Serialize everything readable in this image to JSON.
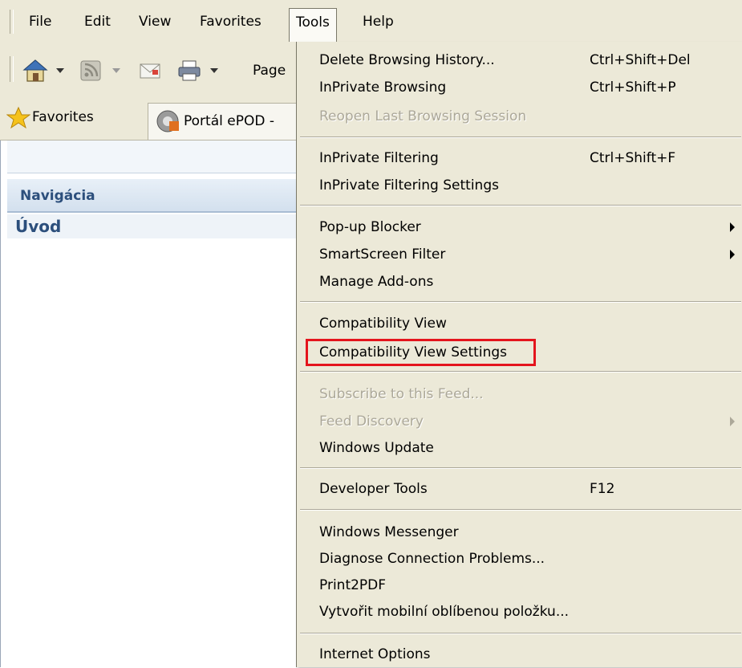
{
  "menubar": {
    "items": [
      "File",
      "Edit",
      "View",
      "Favorites",
      "Tools",
      "Help"
    ],
    "active": "Tools"
  },
  "commandbar": {
    "page_label": "Page"
  },
  "favoritesbar": {
    "favorites_label": "Favorites",
    "tab_title": "Portál ePOD -"
  },
  "page": {
    "nav_header": "Navigácia",
    "nav_items": [
      "Úvod"
    ]
  },
  "tools_menu": {
    "groups": [
      [
        {
          "label": "Delete Browsing History...",
          "shortcut": "Ctrl+Shift+Del",
          "enabled": true
        },
        {
          "label": "InPrivate Browsing",
          "shortcut": "Ctrl+Shift+P",
          "enabled": true
        },
        {
          "label": "Reopen Last Browsing Session",
          "shortcut": "",
          "enabled": false
        }
      ],
      [
        {
          "label": "InPrivate Filtering",
          "shortcut": "Ctrl+Shift+F",
          "enabled": true
        },
        {
          "label": "InPrivate Filtering Settings",
          "shortcut": "",
          "enabled": true
        }
      ],
      [
        {
          "label": "Pop-up Blocker",
          "shortcut": "",
          "enabled": true,
          "submenu": true
        },
        {
          "label": "SmartScreen Filter",
          "shortcut": "",
          "enabled": true,
          "submenu": true
        },
        {
          "label": "Manage Add-ons",
          "shortcut": "",
          "enabled": true
        }
      ],
      [
        {
          "label": "Compatibility View",
          "shortcut": "",
          "enabled": true
        },
        {
          "label": "Compatibility View Settings",
          "shortcut": "",
          "enabled": true,
          "highlighted": true
        }
      ],
      [
        {
          "label": "Subscribe to this Feed...",
          "shortcut": "",
          "enabled": false
        },
        {
          "label": "Feed Discovery",
          "shortcut": "",
          "enabled": false,
          "submenu": true
        },
        {
          "label": "Windows Update",
          "shortcut": "",
          "enabled": true
        }
      ],
      [
        {
          "label": "Developer Tools",
          "shortcut": "F12",
          "enabled": true
        }
      ],
      [
        {
          "label": "Windows Messenger",
          "shortcut": "",
          "enabled": true
        },
        {
          "label": "Diagnose Connection Problems...",
          "shortcut": "",
          "enabled": true
        },
        {
          "label": "Print2PDF",
          "shortcut": "",
          "enabled": true
        },
        {
          "label": "Vytvořit mobilní oblíbenou položku...",
          "shortcut": "",
          "enabled": true
        }
      ],
      [
        {
          "label": "Internet Options",
          "shortcut": "",
          "enabled": true
        }
      ]
    ]
  },
  "colors": {
    "chrome_bg": "#ece9d8",
    "disabled_text": "#aca899",
    "highlight_border": "#e4151d",
    "nav_text": "#2c4f7c"
  }
}
